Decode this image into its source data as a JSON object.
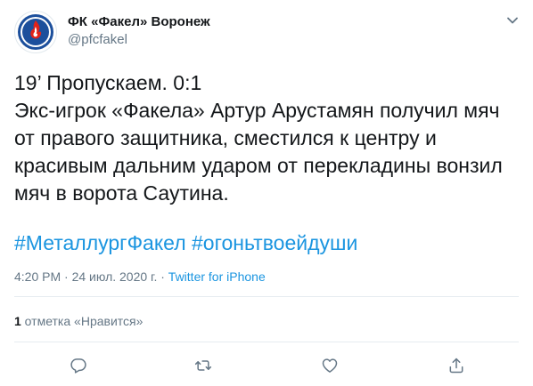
{
  "author": {
    "name": "ФК «Факел» Воронеж",
    "handle": "@pfcfakel"
  },
  "tweet": {
    "lines": [
      "19’ Пропускаем. 0:1",
      "Экс-игрок «Факела» Артур Арустамян получил мяч",
      "от правого защитника, сместился к центру и",
      "красивым дальним ударом от перекладины вонзил",
      "мяч в ворота Саутина."
    ],
    "hashtags": [
      "#МеталлургФакел",
      "#огоньтвоейдуши"
    ],
    "time": "4:20 PM",
    "date_separator": " · ",
    "date": "24 июл. 2020 г.",
    "source_separator": " · ",
    "source": "Twitter for iPhone"
  },
  "stats": {
    "likes_count": "1",
    "likes_label": " отметка «Нравится»"
  },
  "colors": {
    "link": "#1b95e0",
    "muted": "#657786",
    "brand_blue": "#1c4f9c",
    "brand_red": "#e2231a"
  },
  "icons": {
    "more": "chevron-down-icon",
    "reply": "reply-icon",
    "retweet": "retweet-icon",
    "like": "heart-icon",
    "share": "share-icon"
  }
}
